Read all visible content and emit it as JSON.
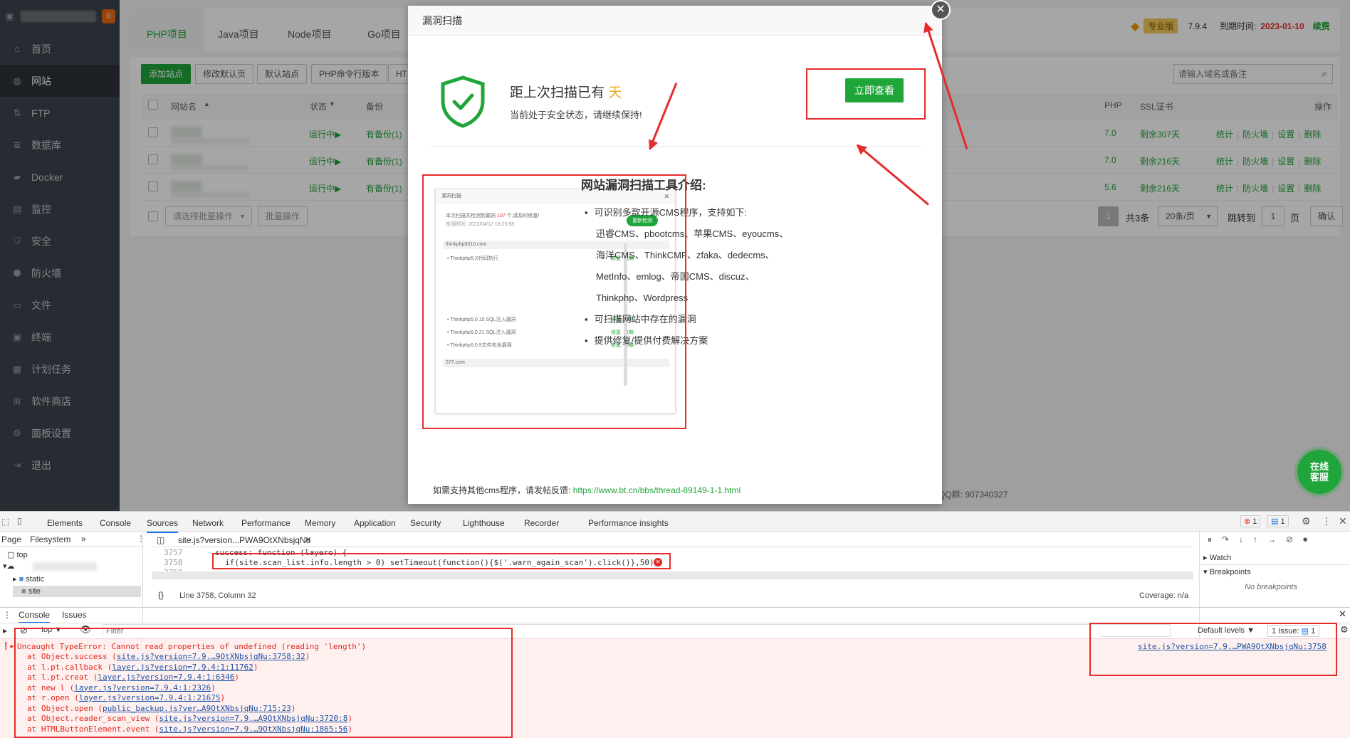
{
  "sidebar": {
    "badge": "0",
    "items": [
      {
        "label": "首页",
        "icon": "home-icon"
      },
      {
        "label": "网站",
        "icon": "globe-icon",
        "active": true
      },
      {
        "label": "FTP",
        "icon": "ftp-icon"
      },
      {
        "label": "数据库",
        "icon": "database-icon"
      },
      {
        "label": "Docker",
        "icon": "docker-icon"
      },
      {
        "label": "监控",
        "icon": "monitor-icon"
      },
      {
        "label": "安全",
        "icon": "shield-icon"
      },
      {
        "label": "防火墙",
        "icon": "firewall-icon"
      },
      {
        "label": "文件",
        "icon": "folder-icon"
      },
      {
        "label": "终端",
        "icon": "terminal-icon"
      },
      {
        "label": "计划任务",
        "icon": "calendar-icon"
      },
      {
        "label": "软件商店",
        "icon": "apps-icon"
      },
      {
        "label": "面板设置",
        "icon": "gear-icon"
      },
      {
        "label": "退出",
        "icon": "logout-icon"
      }
    ]
  },
  "header": {
    "tabs": [
      "PHP项目",
      "Java项目",
      "Node项目",
      "Go项目"
    ],
    "pro_label": "专业版",
    "version": "7.9.4",
    "expire_label": "到期时间:",
    "expire_date": "2023-01-10",
    "renew": "续费"
  },
  "toolbar": {
    "add_site": "添加站点",
    "edit_default_page": "修改默认页",
    "default_site": "默认站点",
    "php_cli": "PHP命令行版本",
    "ht": "HT",
    "search_placeholder": "请输入域名或备注"
  },
  "table": {
    "headers": {
      "name": "网站名",
      "status": "状态",
      "backup": "备份",
      "php": "PHP",
      "ssl": "SSL证书",
      "ops": "操作"
    },
    "rows": [
      {
        "status": "运行中▶",
        "backup": "有备份(1)",
        "php": "7.0",
        "ssl": "剩余307天"
      },
      {
        "status": "运行中▶",
        "backup": "有备份(1)",
        "php": "7.0",
        "ssl": "剩余216天"
      },
      {
        "status": "运行中▶",
        "backup": "有备份(1)",
        "php": "5.6",
        "ssl": "剩余216天"
      }
    ],
    "row_ops": [
      "统计",
      "防火墙",
      "设置",
      "删除"
    ],
    "batch_select": "请选择批量操作",
    "batch_btn": "批量操作",
    "page": "1",
    "total": "共3条",
    "per_page": "20条/页",
    "jump_label": "跳转到",
    "jump_value": "1",
    "page_unit": "页",
    "confirm": "确认"
  },
  "footer": {
    "qq": "QQ群: 907340327"
  },
  "float_service": {
    "line1": "在线",
    "line2": "客服"
  },
  "modal": {
    "title": "漏洞扫描",
    "last_scan_prefix": "距上次扫描已有",
    "last_scan_days": "天",
    "safe_text": "当前处于安全状态，请继续保持!",
    "view_now": "立即查看",
    "intro_title": "网站漏洞扫描工具介绍:",
    "bullets": [
      "可识别多款开源CMS程序，支持如下:",
      "可扫描网站中存在的漏洞",
      "提供修复/提供付费解决方案"
    ],
    "cms_lines": [
      "迅睿CMS、pbootcms、苹果CMS、eyoucms、",
      "海洋CMS、ThinkCMF、zfaka、dedecms、",
      "MetInfo、emlog、帝国CMS、discuz、",
      "Thinkphp、Wordpress"
    ],
    "footer_prefix": "如需支持其他cms程序，请发帖反馈:",
    "footer_link": "https://www.bt.cn/bbs/thread-89149-1-1.html",
    "preview": {
      "title": "漏洞扫描",
      "summary_prefix": "本次扫描共检测到漏洞",
      "summary_count": "107",
      "summary_suffix": "个,请及时修复!",
      "scan_time": "检测时间: 2022/04/12 18:25:58",
      "rescan": "重新检测",
      "site1": "thinkphp5010.com",
      "site2": "577.com",
      "items": [
        "Thinkphp5.X代码执行",
        "Thinkphp5.0.10 SQL注入漏洞",
        "Thinkphp5.0.21 SQL注入漏洞",
        "Thinkphp5.0.9文件包含漏洞"
      ],
      "fix": "修复",
      "ignore": "忽略"
    }
  },
  "devtools": {
    "tabs": [
      "Elements",
      "Console",
      "Sources",
      "Network",
      "Performance",
      "Memory",
      "Application",
      "Security",
      "Lighthouse",
      "Recorder",
      "Performance insights"
    ],
    "error_count": "1",
    "issue_count": "1",
    "nav": {
      "page": "Page",
      "filesystem": "Filesystem",
      "top": "top",
      "static": "static",
      "site": "site"
    },
    "file_tab": "site.js?version...PWA9OtXNbsjqNu",
    "code": {
      "l1_num": "3757",
      "l1": "success: function (layero) {",
      "l2_num": "3758",
      "l2": "if(site.scan_list.info.length > 0) setTimeout(function(){$('.warn_again_scan').click()},50);",
      "l3_num": "3759"
    },
    "status_line": "Line 3758, Column 32",
    "coverage": "Coverage: n/a",
    "watch": "Watch",
    "breakpoints": "Breakpoints",
    "no_breakpoints": "No breakpoints",
    "console_tabs": [
      "Console",
      "Issues"
    ],
    "context": "top",
    "filter_placeholder": "Filter",
    "default_levels": "Default levels",
    "issue_badge": "1 Issue:",
    "issue_badge_count": "1",
    "error_source": "site.js?version=7.9.…PWA9OtXNbsjqNu:3758",
    "error_main": "Uncaught TypeError: Cannot read properties of undefined (reading 'length')",
    "stack": [
      {
        "fn": "at Object.success",
        "src": "site.js?version=7.9.…9OtXNbsjqNu:3758:32"
      },
      {
        "fn": "at l.pt.callback",
        "src": "layer.js?version=7.9.4:1:11762"
      },
      {
        "fn": "at l.pt.creat",
        "src": "layer.js?version=7.9.4:1:6346"
      },
      {
        "fn": "at new l",
        "src": "layer.js?version=7.9.4:1:2326"
      },
      {
        "fn": "at r.open",
        "src": "layer.js?version=7.9.4:1:21675"
      },
      {
        "fn": "at Object.open",
        "src": "public_backup.js?ver…A9OtXNbsjqNu:715:23"
      },
      {
        "fn": "at Object.reader_scan_view",
        "src": "site.js?version=7.9.…A9OtXNbsjqNu:3720:8"
      },
      {
        "fn": "at HTMLButtonElement.event",
        "src": "site.js?version=7.9.…9OtXNbsjqNu:1865:56"
      }
    ]
  }
}
